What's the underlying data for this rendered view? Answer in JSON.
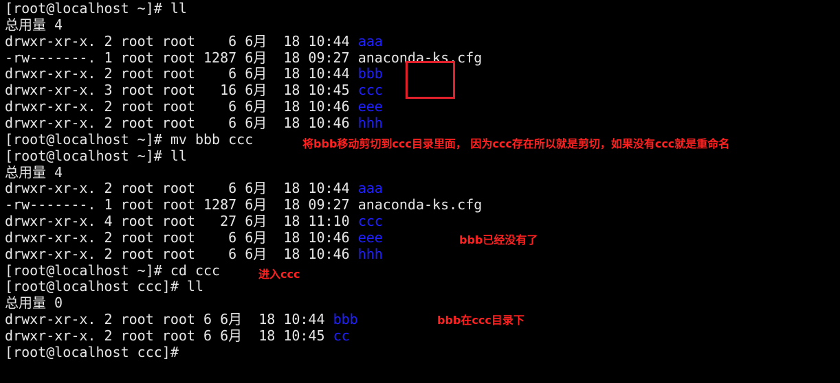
{
  "colors": {
    "background": "#000000",
    "text": "#e6e6e6",
    "directory": "#1f1fff",
    "annotation": "#ff2020",
    "highlight_box": "#e0202a"
  },
  "lines": [
    {
      "prefix": "[root@localhost ~]# ll"
    },
    {
      "prefix": "总用量 4"
    },
    {
      "prefix": "drwxr-xr-x. 2 root root    6 6月  18 10:44 ",
      "name": "aaa",
      "is_dir": true
    },
    {
      "prefix": "-rw-------. 1 root root 1287 6月  18 09:27 ",
      "name": "anaconda-ks.cfg",
      "is_dir": false
    },
    {
      "prefix": "drwxr-xr-x. 2 root root    6 6月  18 10:44 ",
      "name": "bbb",
      "is_dir": true
    },
    {
      "prefix": "drwxr-xr-x. 3 root root   16 6月  18 10:45 ",
      "name": "ccc",
      "is_dir": true
    },
    {
      "prefix": "drwxr-xr-x. 2 root root    6 6月  18 10:46 ",
      "name": "eee",
      "is_dir": true
    },
    {
      "prefix": "drwxr-xr-x. 2 root root    6 6月  18 10:46 ",
      "name": "hhh",
      "is_dir": true
    },
    {
      "prefix": "[root@localhost ~]# mv bbb ccc"
    },
    {
      "prefix": "[root@localhost ~]# ll"
    },
    {
      "prefix": "总用量 4"
    },
    {
      "prefix": "drwxr-xr-x. 2 root root    6 6月  18 10:44 ",
      "name": "aaa",
      "is_dir": true
    },
    {
      "prefix": "-rw-------. 1 root root 1287 6月  18 09:27 ",
      "name": "anaconda-ks.cfg",
      "is_dir": false
    },
    {
      "prefix": "drwxr-xr-x. 4 root root   27 6月  18 11:10 ",
      "name": "ccc",
      "is_dir": true
    },
    {
      "prefix": "drwxr-xr-x. 2 root root    6 6月  18 10:46 ",
      "name": "eee",
      "is_dir": true
    },
    {
      "prefix": "drwxr-xr-x. 2 root root    6 6月  18 10:46 ",
      "name": "hhh",
      "is_dir": true
    },
    {
      "prefix": "[root@localhost ~]# cd ccc"
    },
    {
      "prefix": "[root@localhost ccc]# ll"
    },
    {
      "prefix": "总用量 0"
    },
    {
      "prefix": "drwxr-xr-x. 2 root root 6 6月  18 10:44 ",
      "name": "bbb",
      "is_dir": true
    },
    {
      "prefix": "drwxr-xr-x. 2 root root 6 6月  18 10:45 ",
      "name": "cc",
      "is_dir": true
    },
    {
      "prefix": "[root@localhost ccc]#"
    }
  ],
  "annotations": {
    "mv_note": "将bbb移动剪切到ccc目录里面， 因为ccc存在所以就是剪切，如果没有ccc就是重命名",
    "bbb_gone": "bbb已经没有了",
    "enter_ccc": "进入ccc",
    "bbb_in_ccc": "bbb在ccc目录下"
  }
}
